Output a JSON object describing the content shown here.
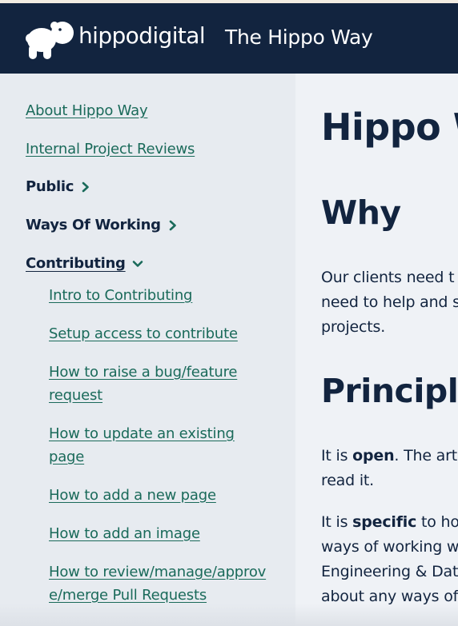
{
  "header": {
    "brand": "hippodigital",
    "site_title": "The Hippo Way",
    "logo_icon": "hippo-logo-icon"
  },
  "sidebar": {
    "links": [
      {
        "label": "About Hippo Way"
      },
      {
        "label": "Internal Project Reviews"
      }
    ],
    "groups": [
      {
        "label": "Public",
        "state": "collapsed"
      },
      {
        "label": "Ways Of Working",
        "state": "collapsed"
      },
      {
        "label": "Contributing",
        "state": "expanded"
      }
    ],
    "contributing_items": [
      {
        "label": "Intro to Contributing"
      },
      {
        "label": "Setup access to contribute"
      },
      {
        "label": "How to raise a bug/feature request"
      },
      {
        "label": "How to update an existing page"
      },
      {
        "label": "How to add a new page"
      },
      {
        "label": "How to add an image"
      },
      {
        "label": "How to review/manage/approve/merge Pull Requests"
      }
    ]
  },
  "main": {
    "title": "Hippo W",
    "why_heading": "Why",
    "why_para": "Our clients need t\nneed to help and s\nprojects.",
    "principles_heading": "Principle",
    "p1_prefix": "It is ",
    "p1_bold": "open",
    "p1_rest": ". The arti",
    "p1_line2": "read it.",
    "p2_prefix": "It is ",
    "p2_bold": "specific",
    "p2_rest": " to ho",
    "p2_line2": "ways of working w",
    "p2_line3": "Engineering & Dat",
    "p2_line4": "about any ways of"
  },
  "colors": {
    "header_bg": "#12243f",
    "link": "#1a6a5a",
    "text": "#12243f",
    "sidebar_bg": "#e7ebf0",
    "main_bg": "#eff2f6"
  }
}
